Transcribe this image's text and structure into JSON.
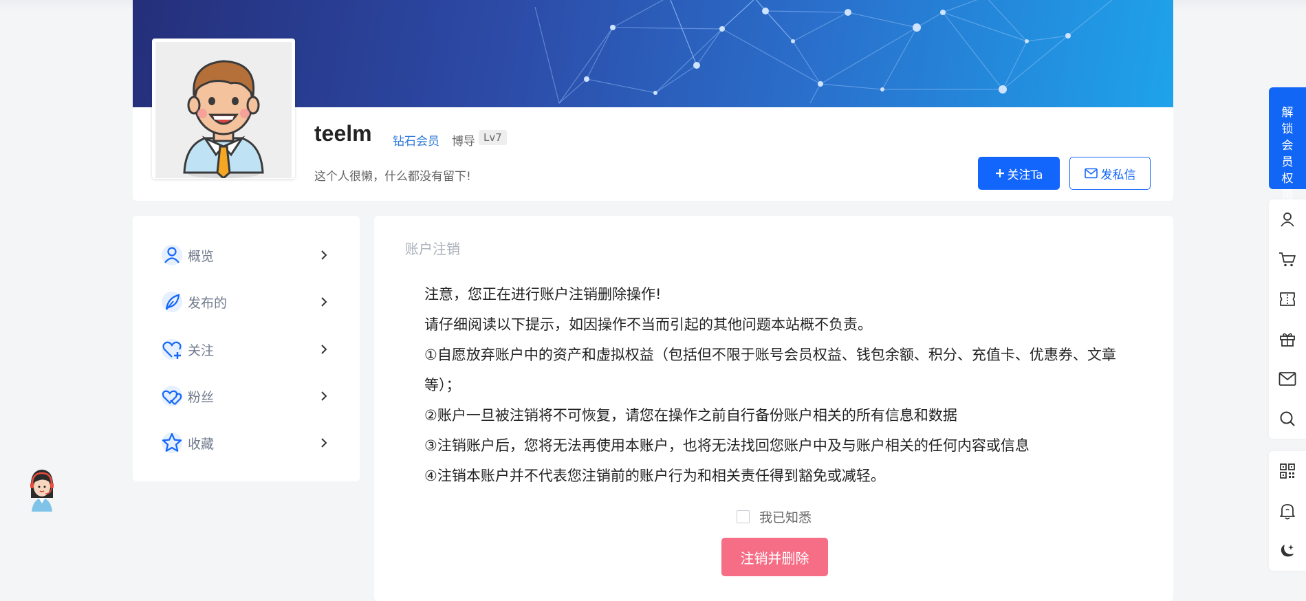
{
  "profile": {
    "username": "teelm",
    "vip_label": "钻石会员",
    "role_label": "博导",
    "level": "Lv7",
    "bio": "这个人很懒，什么都没有留下!",
    "follow_label": "关注Ta",
    "message_label": "发私信"
  },
  "sidebar": {
    "items": [
      {
        "label": "概览",
        "icon": "user-icon"
      },
      {
        "label": "发布的",
        "icon": "feather-icon"
      },
      {
        "label": "关注",
        "icon": "heart-plus-icon"
      },
      {
        "label": "粉丝",
        "icon": "double-heart-icon"
      },
      {
        "label": "收藏",
        "icon": "star-icon"
      }
    ]
  },
  "main": {
    "title": "账户注销",
    "notice": [
      "注意，您正在进行账户注销删除操作!",
      "请仔细阅读以下提示，如因操作不当而引起的其他问题本站概不负责。",
      "①自愿放弃账户中的资产和虚拟权益（包括但不限于账号会员权益、钱包余额、积分、充值卡、优惠券、文章等）；",
      "②账户一旦被注销将不可恢复，请您在操作之前自行备份账户相关的所有信息和数据",
      "③注销账户后，您将无法再使用本账户，也将无法找回您账户中及与账户相关的任何内容或信息",
      "④注销本账户并不代表您注销前的账户行为和相关责任得到豁免或减轻。"
    ],
    "acknowledge_label": "我已知悉",
    "delete_label": "注销并删除"
  },
  "float_bar": {
    "unlock_label": "解锁会员权限",
    "icons": [
      "user-icon",
      "cart-icon",
      "ticket-icon",
      "gift-icon",
      "mail-icon",
      "search-icon",
      "qrcode-icon",
      "bell-icon",
      "moon-icon"
    ]
  },
  "colors": {
    "primary": "#1366fb",
    "danger": "#f66d86",
    "vip": "#2f7ad8"
  }
}
